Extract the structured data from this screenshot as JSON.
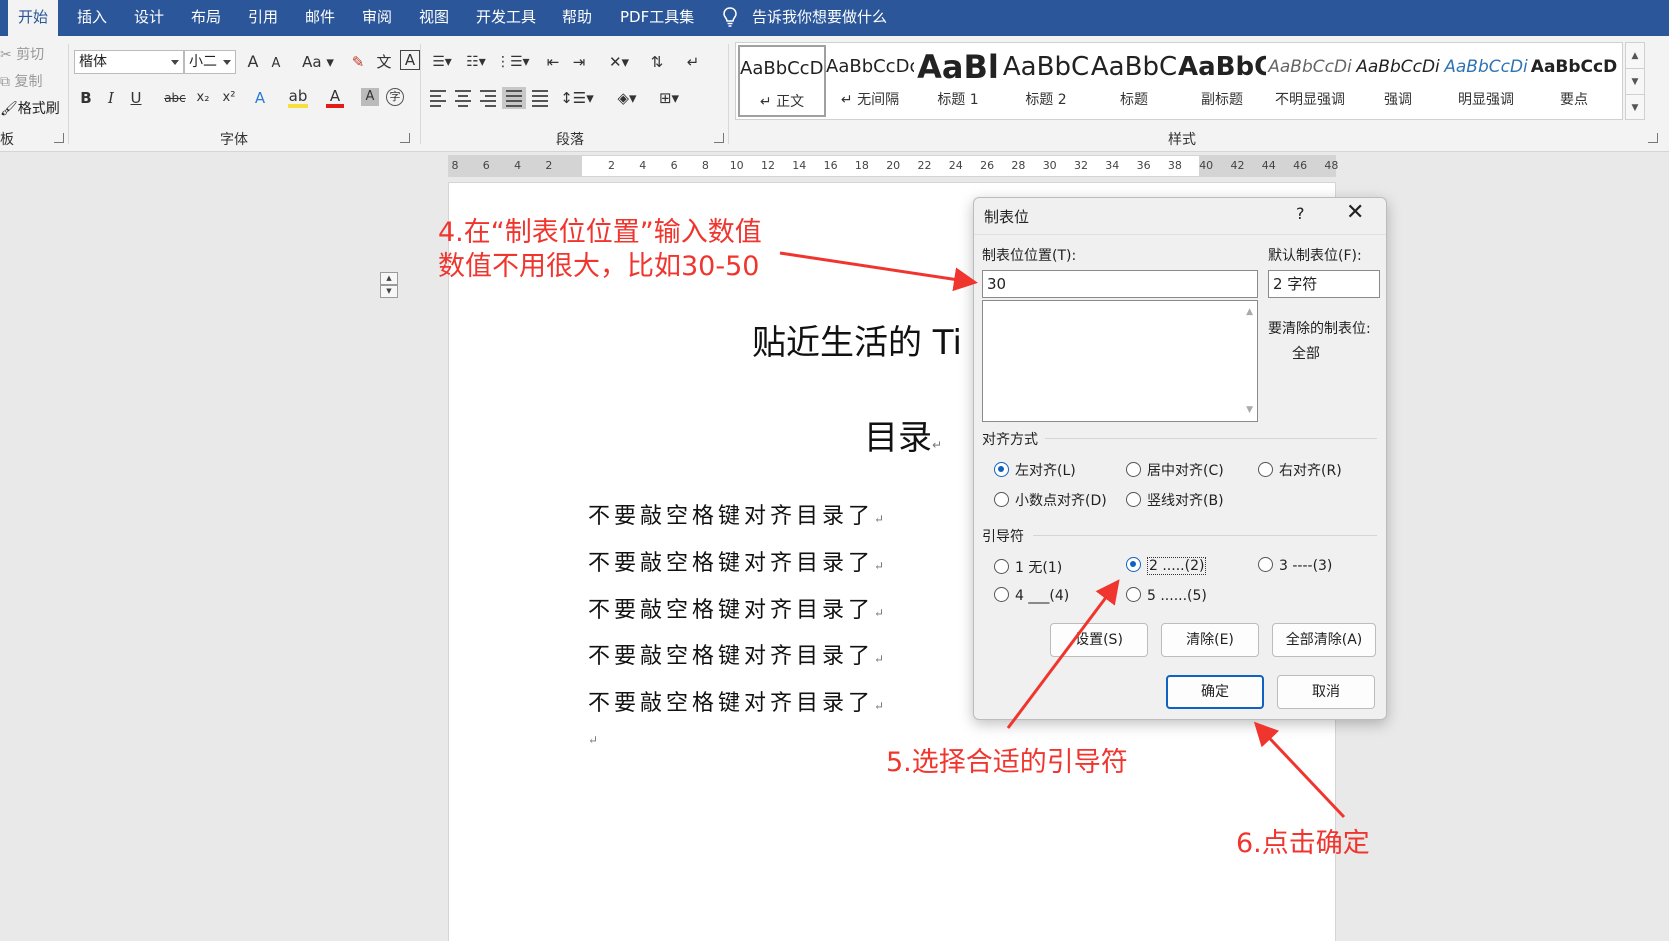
{
  "menu": {
    "tabs": [
      "开始",
      "插入",
      "设计",
      "布局",
      "引用",
      "邮件",
      "审阅",
      "视图",
      "开发工具",
      "帮助",
      "PDF工具集"
    ],
    "active_tab": "开始",
    "tell_me": "告诉我你想要做什么"
  },
  "ribbon": {
    "clipboard": {
      "cut": "剪切",
      "copy": "复制",
      "format_painter": "格式刷",
      "label": "板"
    },
    "font": {
      "name": "楷体",
      "size": "小二",
      "grow": "A",
      "shrink": "A",
      "case": "Aa",
      "bold": "B",
      "italic": "I",
      "underline": "U",
      "strike": "abc",
      "sub": "x₂",
      "sup": "x²",
      "label": "字体"
    },
    "paragraph": {
      "label": "段落"
    },
    "styles": {
      "label": "样式",
      "items": [
        {
          "preview": "AaBbCcDc",
          "name": "↵ 正文"
        },
        {
          "preview": "AaBbCcDc",
          "name": "↵ 无间隔"
        },
        {
          "preview": "AaBl",
          "name": "标题 1"
        },
        {
          "preview": "AaBbC",
          "name": "标题 2"
        },
        {
          "preview": "AaBbC",
          "name": "标题"
        },
        {
          "preview": "AaBbC",
          "name": "副标题"
        },
        {
          "preview": "AaBbCcDi",
          "name": "不明显强调"
        },
        {
          "preview": "AaBbCcDi",
          "name": "强调"
        },
        {
          "preview": "AaBbCcDi",
          "name": "明显强调"
        },
        {
          "preview": "AaBbCcD",
          "name": "要点"
        }
      ]
    }
  },
  "ruler": {
    "numbers": [
      "8",
      "6",
      "4",
      "2",
      "",
      "2",
      "4",
      "6",
      "8",
      "10",
      "12",
      "14",
      "16",
      "18",
      "20",
      "22",
      "24",
      "26",
      "28",
      "30",
      "32",
      "34",
      "36",
      "38",
      "40",
      "42",
      "44",
      "46",
      "48"
    ]
  },
  "document": {
    "title": "贴近生活的 Ti",
    "toc_heading": "目录",
    "para_mark": "↵",
    "toc_lines": [
      "不要敲空格键对齐目录了",
      "不要敲空格键对齐目录了",
      "不要敲空格键对齐目录了",
      "不要敲空格键对齐目录了",
      "不要敲空格键对齐目录了"
    ]
  },
  "dialog": {
    "title": "制表位",
    "help": "?",
    "close": "✕",
    "tab_position_label": "制表位位置(T):",
    "tab_position_value": "30",
    "default_tab_label": "默认制表位(F):",
    "default_tab_value": "2 字符",
    "to_clear_label": "要清除的制表位:",
    "to_clear_value": "全部",
    "alignment_label": "对齐方式",
    "alignment_options": [
      "左对齐(L)",
      "居中对齐(C)",
      "右对齐(R)",
      "小数点对齐(D)",
      "竖线对齐(B)"
    ],
    "alignment_selected": "左对齐(L)",
    "leader_label": "引导符",
    "leader_options": [
      "1 无(1)",
      "2 .....(2)",
      "3 ----(3)",
      "4 ___(4)",
      "5 ......(5)"
    ],
    "leader_selected": "2 .....(2)",
    "set_button": "设置(S)",
    "clear_button": "清除(E)",
    "clear_all_button": "全部清除(A)",
    "ok_button": "确定",
    "cancel_button": "取消"
  },
  "annotations": {
    "step4_line1": "4.在“制表位位置”输入数值",
    "step4_line2": "数值不用很大，比如30-50",
    "step5": "5.选择合适的引导符",
    "step6": "6.点击确定",
    "color": "#f0352e"
  },
  "colors": {
    "title_bar": "#2b579a",
    "accent": "#0f62c2"
  }
}
